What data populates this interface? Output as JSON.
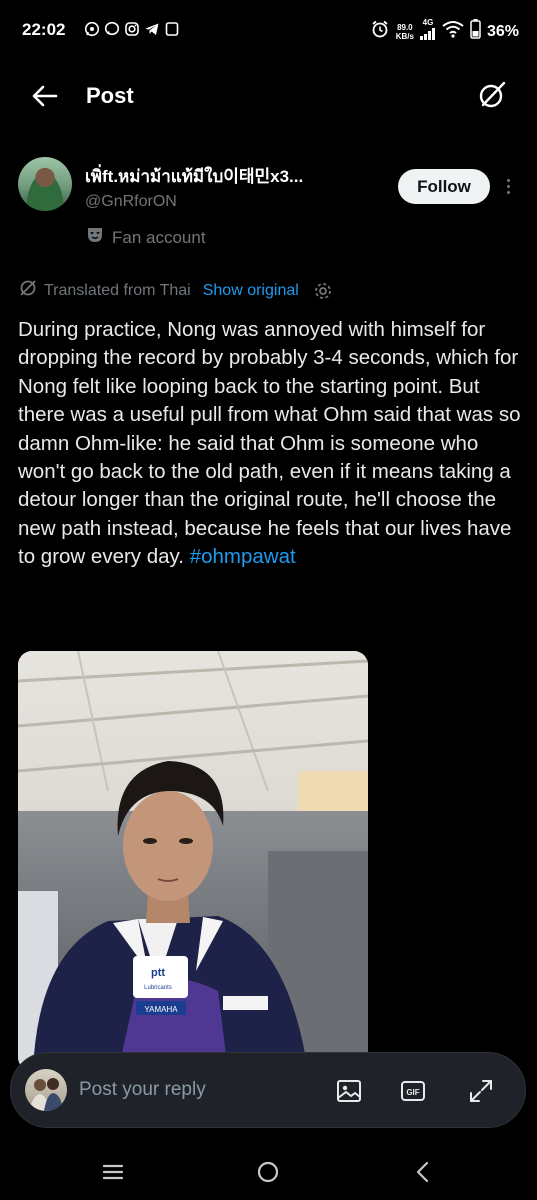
{
  "status_bar": {
    "time": "22:02",
    "net_speed_value": "89.0",
    "net_speed_unit": "KB/s",
    "network": "4G",
    "battery": "36%",
    "left_icons": [
      "whatsapp-icon",
      "messenger-icon",
      "instagram-icon",
      "telegram-icon",
      "app-square-icon"
    ],
    "right_icons": [
      "alarm-icon",
      "signal-icon",
      "wifi-icon",
      "battery-icon"
    ]
  },
  "header": {
    "title": "Post",
    "back_icon": "back-arrow-icon",
    "action_icon": "grok-icon"
  },
  "author": {
    "name": "เพิ่ft.หม่าม้าแท้มีใบ이태민x3...",
    "handle": "@GnRforON",
    "follow_label": "Follow",
    "badge_label": "Fan account",
    "badge_icon": "theater-mask-icon"
  },
  "translation": {
    "label": "Translated from Thai",
    "show_original": "Show original",
    "settings_icon": "gear-icon"
  },
  "post": {
    "text": "During practice, Nong was annoyed with himself for dropping the record by probably 3-4 seconds, which for Nong felt like looping back to the starting point. But there was a useful pull from what Ohm said that was so damn Ohm-like: he said that Ohm is someone who won't go back to the old path, even if it means taking a detour longer than the original route, he'll choose the new path instead, because he feels that our lives have to grow every day.",
    "hashtag": "#ohmpawat",
    "media_jersey_text_1": "ptt",
    "media_jersey_text_2": "Lubricants",
    "media_jersey_text_3": "YAMAHA"
  },
  "reply": {
    "placeholder": "Post your reply",
    "icons": [
      "image-icon",
      "gif-icon",
      "expand-icon"
    ],
    "gif_label": "GIF"
  },
  "colors": {
    "background": "#000000",
    "accent": "#1d9bf0",
    "text_primary": "#e7e9ea",
    "text_secondary": "#71767b"
  }
}
